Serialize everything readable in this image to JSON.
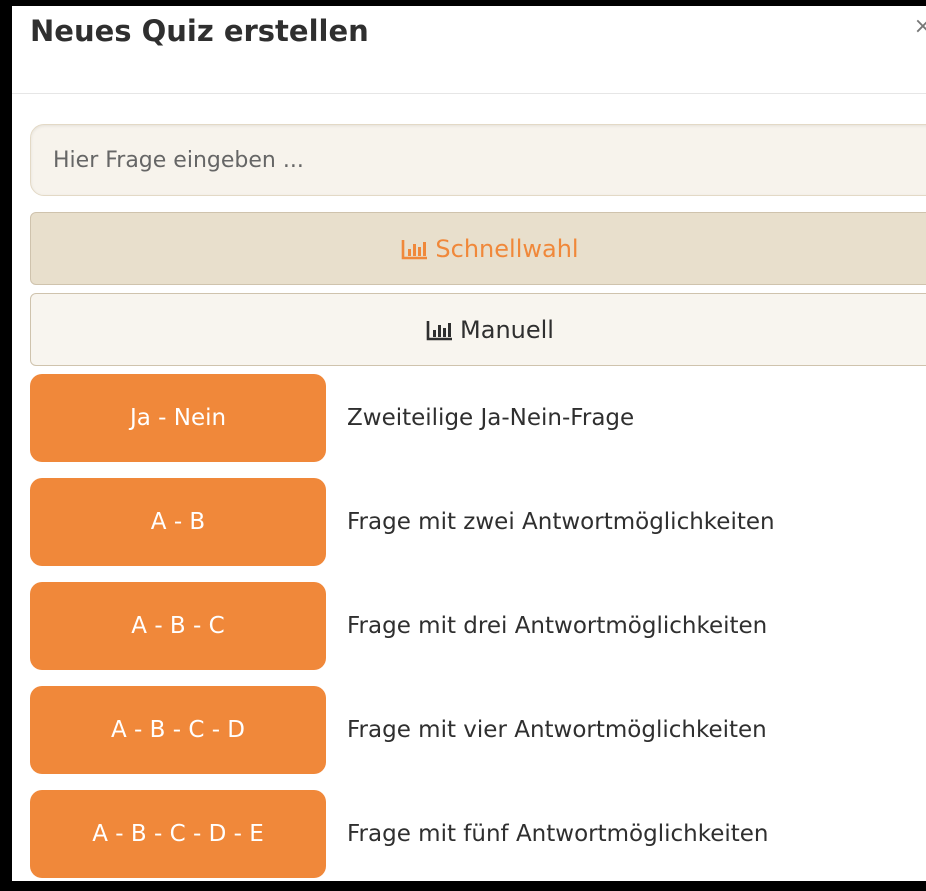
{
  "dialog": {
    "title": "Neues Quiz erstellen",
    "close_glyph": "×"
  },
  "question": {
    "placeholder": "Hier Frage eingeben ...",
    "value": ""
  },
  "modes": [
    {
      "label": "Schnellwahl",
      "icon": "bar-chart-icon",
      "active": true
    },
    {
      "label": "Manuell",
      "icon": "bar-chart-icon",
      "active": false
    }
  ],
  "choices": [
    {
      "button": "Ja - Nein",
      "description": "Zweiteilige Ja-Nein-Frage"
    },
    {
      "button": "A - B",
      "description": "Frage mit zwei Antwortmöglichkeiten"
    },
    {
      "button": "A - B - C",
      "description": "Frage mit drei Antwortmöglichkeiten"
    },
    {
      "button": "A - B - C - D",
      "description": "Frage mit vier Antwortmöglichkeiten"
    },
    {
      "button": "A - B - C - D - E",
      "description": "Frage mit fünf Antwortmöglichkeiten"
    }
  ],
  "colors": {
    "accent": "#f0883a",
    "active_bg": "#e8dfcc",
    "input_bg": "#f7f3ec"
  }
}
